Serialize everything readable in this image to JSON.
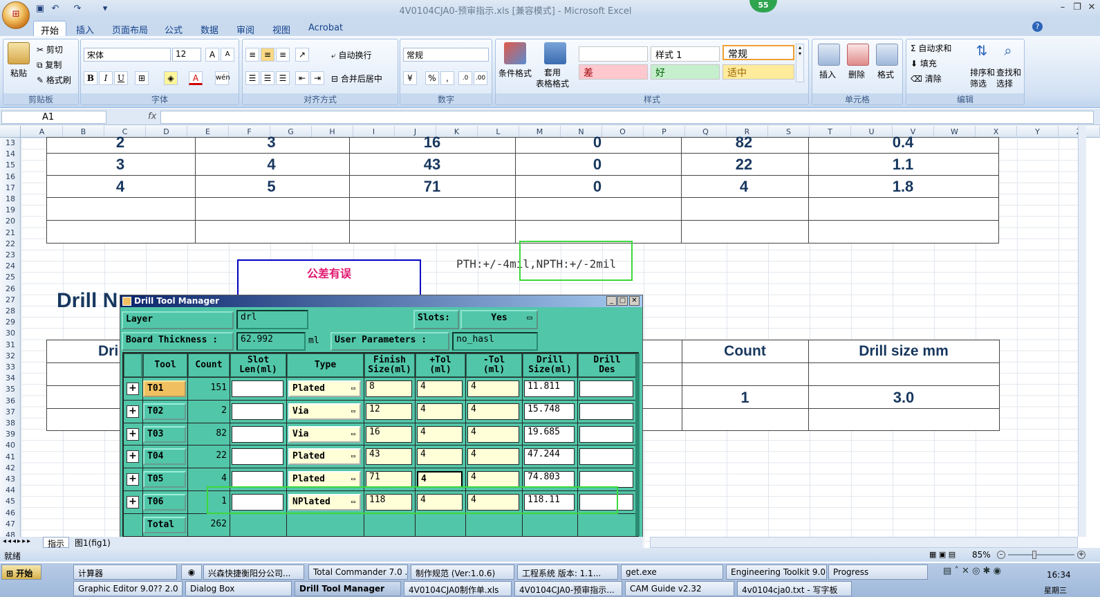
{
  "window": {
    "title": "4V0104CJA0-预审指示.xls  [兼容模式] - Microsoft Excel",
    "badge": "55"
  },
  "ribbon_tabs": [
    "开始",
    "插入",
    "页面布局",
    "公式",
    "数据",
    "审阅",
    "视图",
    "Acrobat"
  ],
  "clipboard": {
    "paste": "粘贴",
    "cut": "剪切",
    "copy": "复制",
    "format_painter": "格式刷",
    "label": "剪贴板"
  },
  "font": {
    "name": "宋体",
    "size": "12",
    "label": "字体",
    "bold": "B",
    "italic": "I",
    "underline": "U"
  },
  "alignment": {
    "wrap": "自动换行",
    "merge": "合并后居中",
    "label": "对齐方式"
  },
  "number": {
    "format": "常规",
    "label": "数字",
    "percent": "%",
    "comma": ","
  },
  "styles": {
    "conditional": "条件格式",
    "table": "套用\n表格格式",
    "style1": "样式 1",
    "normal": "常规",
    "bad": "差",
    "good": "好",
    "neutral": "适中",
    "label": "样式"
  },
  "cells": {
    "insert": "插入",
    "delete": "删除",
    "format": "格式",
    "label": "单元格"
  },
  "editing": {
    "autosum": "自动求和",
    "fill": "填充",
    "clear": "清除",
    "sort": "排序和\n筛选",
    "find": "查找和\n选择",
    "label": "编辑"
  },
  "formula_bar": {
    "name_box": "A1",
    "fx": "fx"
  },
  "columns": [
    "A",
    "B",
    "C",
    "D",
    "E",
    "F",
    "G",
    "H",
    "I",
    "J",
    "K",
    "L",
    "M",
    "N",
    "O",
    "P",
    "Q",
    "R",
    "S",
    "T",
    "U",
    "V",
    "W",
    "X",
    "Y",
    "Z"
  ],
  "rows": [
    "13",
    "14",
    "15",
    "16",
    "17",
    "18",
    "19",
    "20",
    "21",
    "22",
    "23",
    "24",
    "25",
    "26",
    "27",
    "28",
    "29",
    "30",
    "31",
    "32",
    "33",
    "34",
    "35",
    "36",
    "37",
    "38",
    "39",
    "40",
    "41",
    "42",
    "43",
    "44",
    "45",
    "46",
    "47",
    "48"
  ],
  "sheet_table_top": [
    [
      "2",
      "3",
      "16",
      "0",
      "82",
      "0.4"
    ],
    [
      "3",
      "4",
      "43",
      "0",
      "22",
      "1.1"
    ],
    [
      "4",
      "5",
      "71",
      "0",
      "4",
      "1.8"
    ]
  ],
  "annotation_text": "公差有误",
  "tolerance_note": "PTH:+/-4mil,NPTH:+/-2mil",
  "drill_heading": "Drill N",
  "drill_table2": {
    "col1_partial": "Dri",
    "count_header": "Count",
    "size_header": "Drill size mm",
    "count_value": "1",
    "size_value": "3.0"
  },
  "dialog": {
    "title": "Drill Tool Manager",
    "layer_label": "Layer                :",
    "layer_value": "drl",
    "slots_label": "Slots:",
    "slots_value": "Yes",
    "thickness_label": "Board Thickness :",
    "thickness_value": "62.992",
    "thickness_unit": "ml",
    "user_params_label": "User Parameters :",
    "user_params_value": "no_hasl",
    "headers": [
      "Tool",
      "Count",
      "Slot\nLen(ml)",
      "Type",
      "Finish\nSize(ml)",
      "+Tol\n(ml)",
      "-Tol\n(ml)",
      "Drill\nSize(ml)",
      "Drill\nDes"
    ],
    "tools": [
      {
        "tool": "T01",
        "count": "151",
        "type": "Plated",
        "finish": "8",
        "ptol": "4",
        "ntol": "4",
        "drill": "11.811"
      },
      {
        "tool": "T02",
        "count": "2",
        "type": "Via",
        "finish": "12",
        "ptol": "4",
        "ntol": "4",
        "drill": "15.748"
      },
      {
        "tool": "T03",
        "count": "82",
        "type": "Via",
        "finish": "16",
        "ptol": "4",
        "ntol": "4",
        "drill": "19.685"
      },
      {
        "tool": "T04",
        "count": "22",
        "type": "Plated",
        "finish": "43",
        "ptol": "4",
        "ntol": "4",
        "drill": "47.244"
      },
      {
        "tool": "T05",
        "count": "4",
        "type": "Plated",
        "finish": "71",
        "ptol": "4",
        "ntol": "4",
        "drill": "74.803"
      },
      {
        "tool": "T06",
        "count": "1",
        "type": "NPlated",
        "finish": "118",
        "ptol": "4",
        "ntol": "4",
        "drill": "118.11"
      }
    ],
    "total_label": "Total",
    "total_value": "262"
  },
  "sheet_tabs": [
    "指示",
    "图1(fig1)"
  ],
  "status": {
    "ready": "就绪",
    "zoom": "85%"
  },
  "taskbar": {
    "start": "开始",
    "row1": [
      "计算器",
      "兴森快捷衡阳分公司...",
      "Total Commander 7.0 ...",
      "制作规范 (Ver:1.0.6)",
      "工程系统  版本: 1.1...",
      "get.exe",
      "Engineering Toolkit 9.0...",
      "Progress"
    ],
    "row2": [
      "Graphic Editor 9.0?? 2.0",
      "Dialog Box",
      "Drill Tool Manager",
      "4V0104CJA0制作单.xls",
      "4V0104CJA0-预审指示...",
      "CAM  Guide v2.32",
      "4v0104cja0.txt - 写字板"
    ],
    "time": "16:34",
    "day": "星期三"
  }
}
